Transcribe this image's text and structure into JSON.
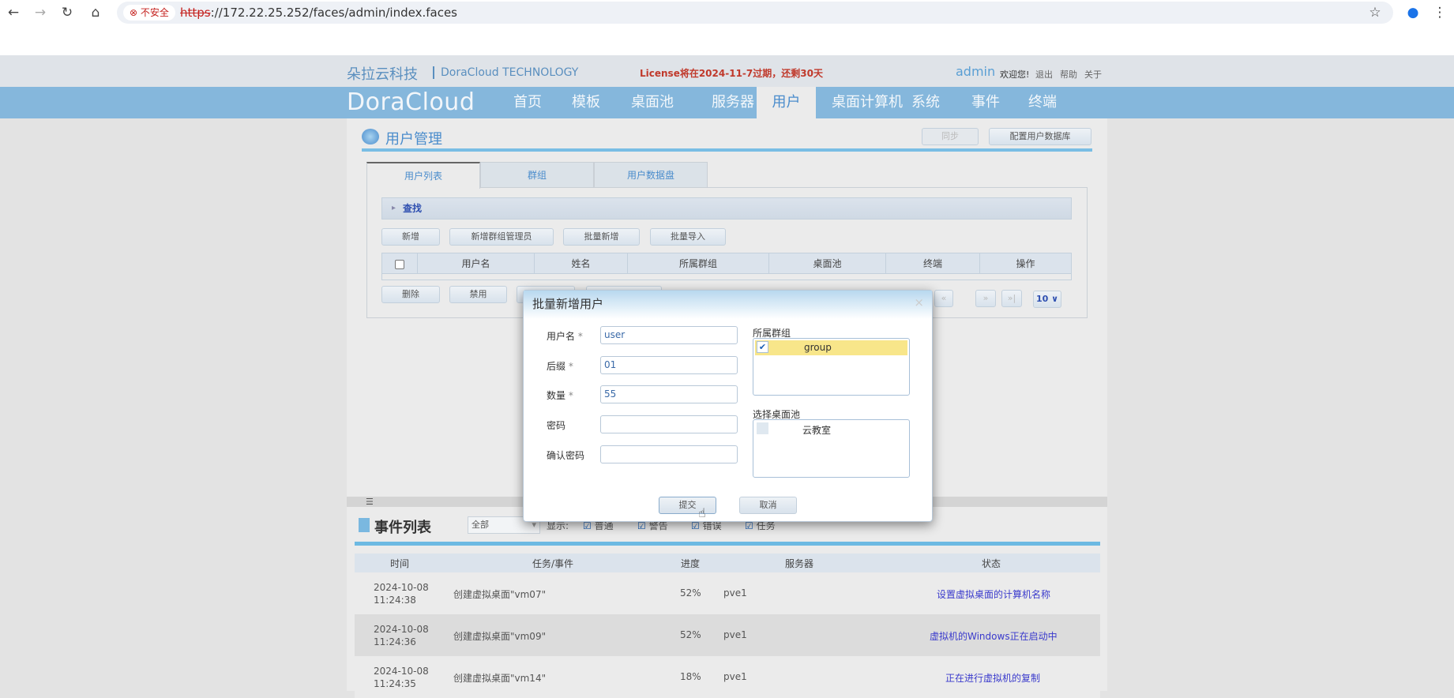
{
  "browser": {
    "security": "不安全",
    "url_scheme": "https",
    "url_rest": "://172.22.25.252/faces/admin/index.faces"
  },
  "header": {
    "brand_cn": "朵拉云科技",
    "brand_en": "DoraCloud TECHNOLOGY",
    "license": "License将在2024-11-7过期，还剩30天",
    "user": "admin",
    "welcome": "欢迎您!",
    "logout": "退出",
    "help": "帮助",
    "about": "关于",
    "logo": "DoraCloud"
  },
  "nav": [
    "首页",
    "模板",
    "桌面池",
    "服务器",
    "用户",
    "桌面计算机",
    "系统",
    "事件",
    "终端"
  ],
  "page": {
    "title": "用户管理",
    "sync": "同步",
    "config_db": "配置用户数据库",
    "tabs": [
      "用户列表",
      "群组",
      "用户数据盘"
    ],
    "find": "查找",
    "actions": [
      "新增",
      "新增群组管理员",
      "批量新增",
      "批量导入"
    ],
    "columns": [
      "用户名",
      "姓名",
      "所属群组",
      "桌面池",
      "终端",
      "操作"
    ],
    "bottom_actions": [
      "删除",
      "禁用"
    ],
    "page_size": "10 ∨"
  },
  "dialog": {
    "title": "批量新增用户",
    "close": "×",
    "fields": [
      {
        "label": "用户名",
        "required": "*",
        "value": "user"
      },
      {
        "label": "后缀",
        "required": "*",
        "value": "01"
      },
      {
        "label": "数量",
        "required": "*",
        "value": "55"
      },
      {
        "label": "密码",
        "required": "",
        "value": ""
      },
      {
        "label": "确认密码",
        "required": "",
        "value": ""
      }
    ],
    "group_label": "所属群组",
    "groups": [
      {
        "name": "group",
        "checked": true
      }
    ],
    "pool_label": "选择桌面池",
    "pools": [
      {
        "name": "云教室",
        "checked": false
      }
    ],
    "submit": "提交",
    "cancel": "取消"
  },
  "events": {
    "title": "事件列表",
    "filter": "全部",
    "show_label": "显示:",
    "filters": [
      "普通",
      "警告",
      "错误",
      "任务"
    ],
    "columns": [
      "时间",
      "任务/事件",
      "进度",
      "服务器",
      "状态"
    ],
    "rows": [
      {
        "date": "2024-10-08",
        "time": "11:24:38",
        "task": "创建虚拟桌面\"vm07\"",
        "progress": "52%",
        "server": "pve1",
        "status": "设置虚拟桌面的计算机名称"
      },
      {
        "date": "2024-10-08",
        "time": "11:24:36",
        "task": "创建虚拟桌面\"vm09\"",
        "progress": "52%",
        "server": "pve1",
        "status": "虚拟机的Windows正在启动中"
      },
      {
        "date": "2024-10-08",
        "time": "11:24:35",
        "task": "创建虚拟桌面\"vm14\"",
        "progress": "18%",
        "server": "pve1",
        "status": "正在进行虚拟机的复制"
      }
    ]
  }
}
